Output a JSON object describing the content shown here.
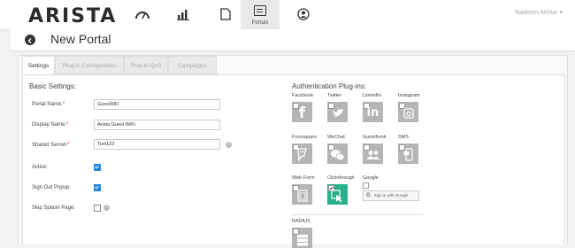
{
  "app": {
    "logo": "ARISTA",
    "user_name": "Nadeem Akhtar"
  },
  "nav": {
    "active_label": "Portals"
  },
  "page": {
    "title": "New Portal"
  },
  "tabs": [
    "Settings",
    "Plug-in Configuration",
    "Plug-in QoS",
    "Campaigns"
  ],
  "basic": {
    "title": "Basic Settings:",
    "portal_name_label": "Portal Name:",
    "portal_name_value": "GuesWiFi",
    "display_name_label": "Display Name:",
    "display_name_value": "Arista Guest WiFi",
    "shared_secret_label": "Shared Secret:",
    "shared_secret_value": "Test123",
    "required_mark": "*",
    "active_label": "Active:",
    "signout_label": "Sign Out Popup:",
    "skip_label": "Skip Splash Page:"
  },
  "auth": {
    "title": "Authentication Plug-ins:",
    "plugins": [
      "Facebook",
      "Twitter",
      "LinkedIn",
      "Instagram",
      "Foursquare",
      "WeChat",
      "Guestbook",
      "SMS",
      "Web Form",
      "Clickthrough",
      "Google",
      "RADIUS"
    ],
    "google_button": "Sign in with Google"
  }
}
